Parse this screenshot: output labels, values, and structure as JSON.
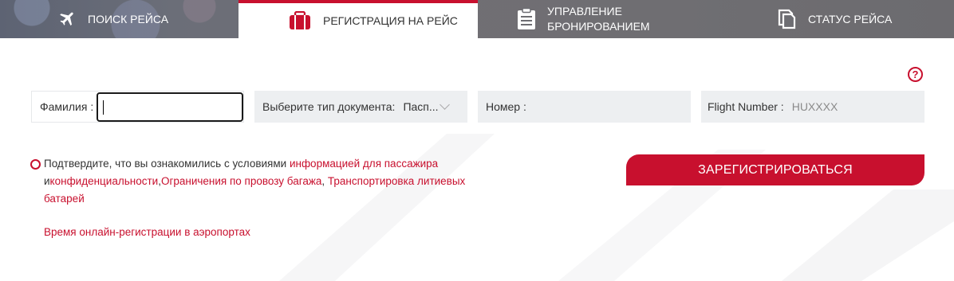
{
  "tabs": [
    {
      "label": "ПОИСК РЕЙСА",
      "icon": "airplane-icon",
      "active": false
    },
    {
      "label": "РЕГИСТРАЦИЯ НА РЕЙС",
      "icon": "suitcase-icon",
      "active": true
    },
    {
      "label_line1": "УПРАВЛЕНИЕ",
      "label_line2": "БРОНИРОВАНИЕМ",
      "icon": "clipboard-icon",
      "active": false
    },
    {
      "label": "СТАТУС РЕЙСА",
      "icon": "documents-icon",
      "active": false
    }
  ],
  "help": {
    "label": "?"
  },
  "form": {
    "surname_label": "Фамилия :",
    "surname_value": "",
    "doctype_label": "Выберите тип документа:",
    "doctype_value": "Пасп...",
    "number_label": "Номер :",
    "number_value": "",
    "flight_label": "Flight Number :",
    "flight_placeholder": "HUXXXX"
  },
  "consent": {
    "text_before": "Подтвердите, что вы ознакомились с условиями ",
    "link_passenger_info": "информацией для пассажира",
    "connector": "и",
    "link_privacy": "конфиденциальности",
    "link_baggage": "Ограничения по провозу багажа",
    "link_batteries": "Транспортировка литиевых батарей"
  },
  "online_checkin_link": "Время онлайн-регистрации в аэропортах",
  "submit_label": "ЗАРЕГИСТРИРОВАТЬСЯ",
  "colors": {
    "accent": "#c8102e",
    "field_bg": "#edeff1",
    "tab_bar": "#6d6d72"
  }
}
